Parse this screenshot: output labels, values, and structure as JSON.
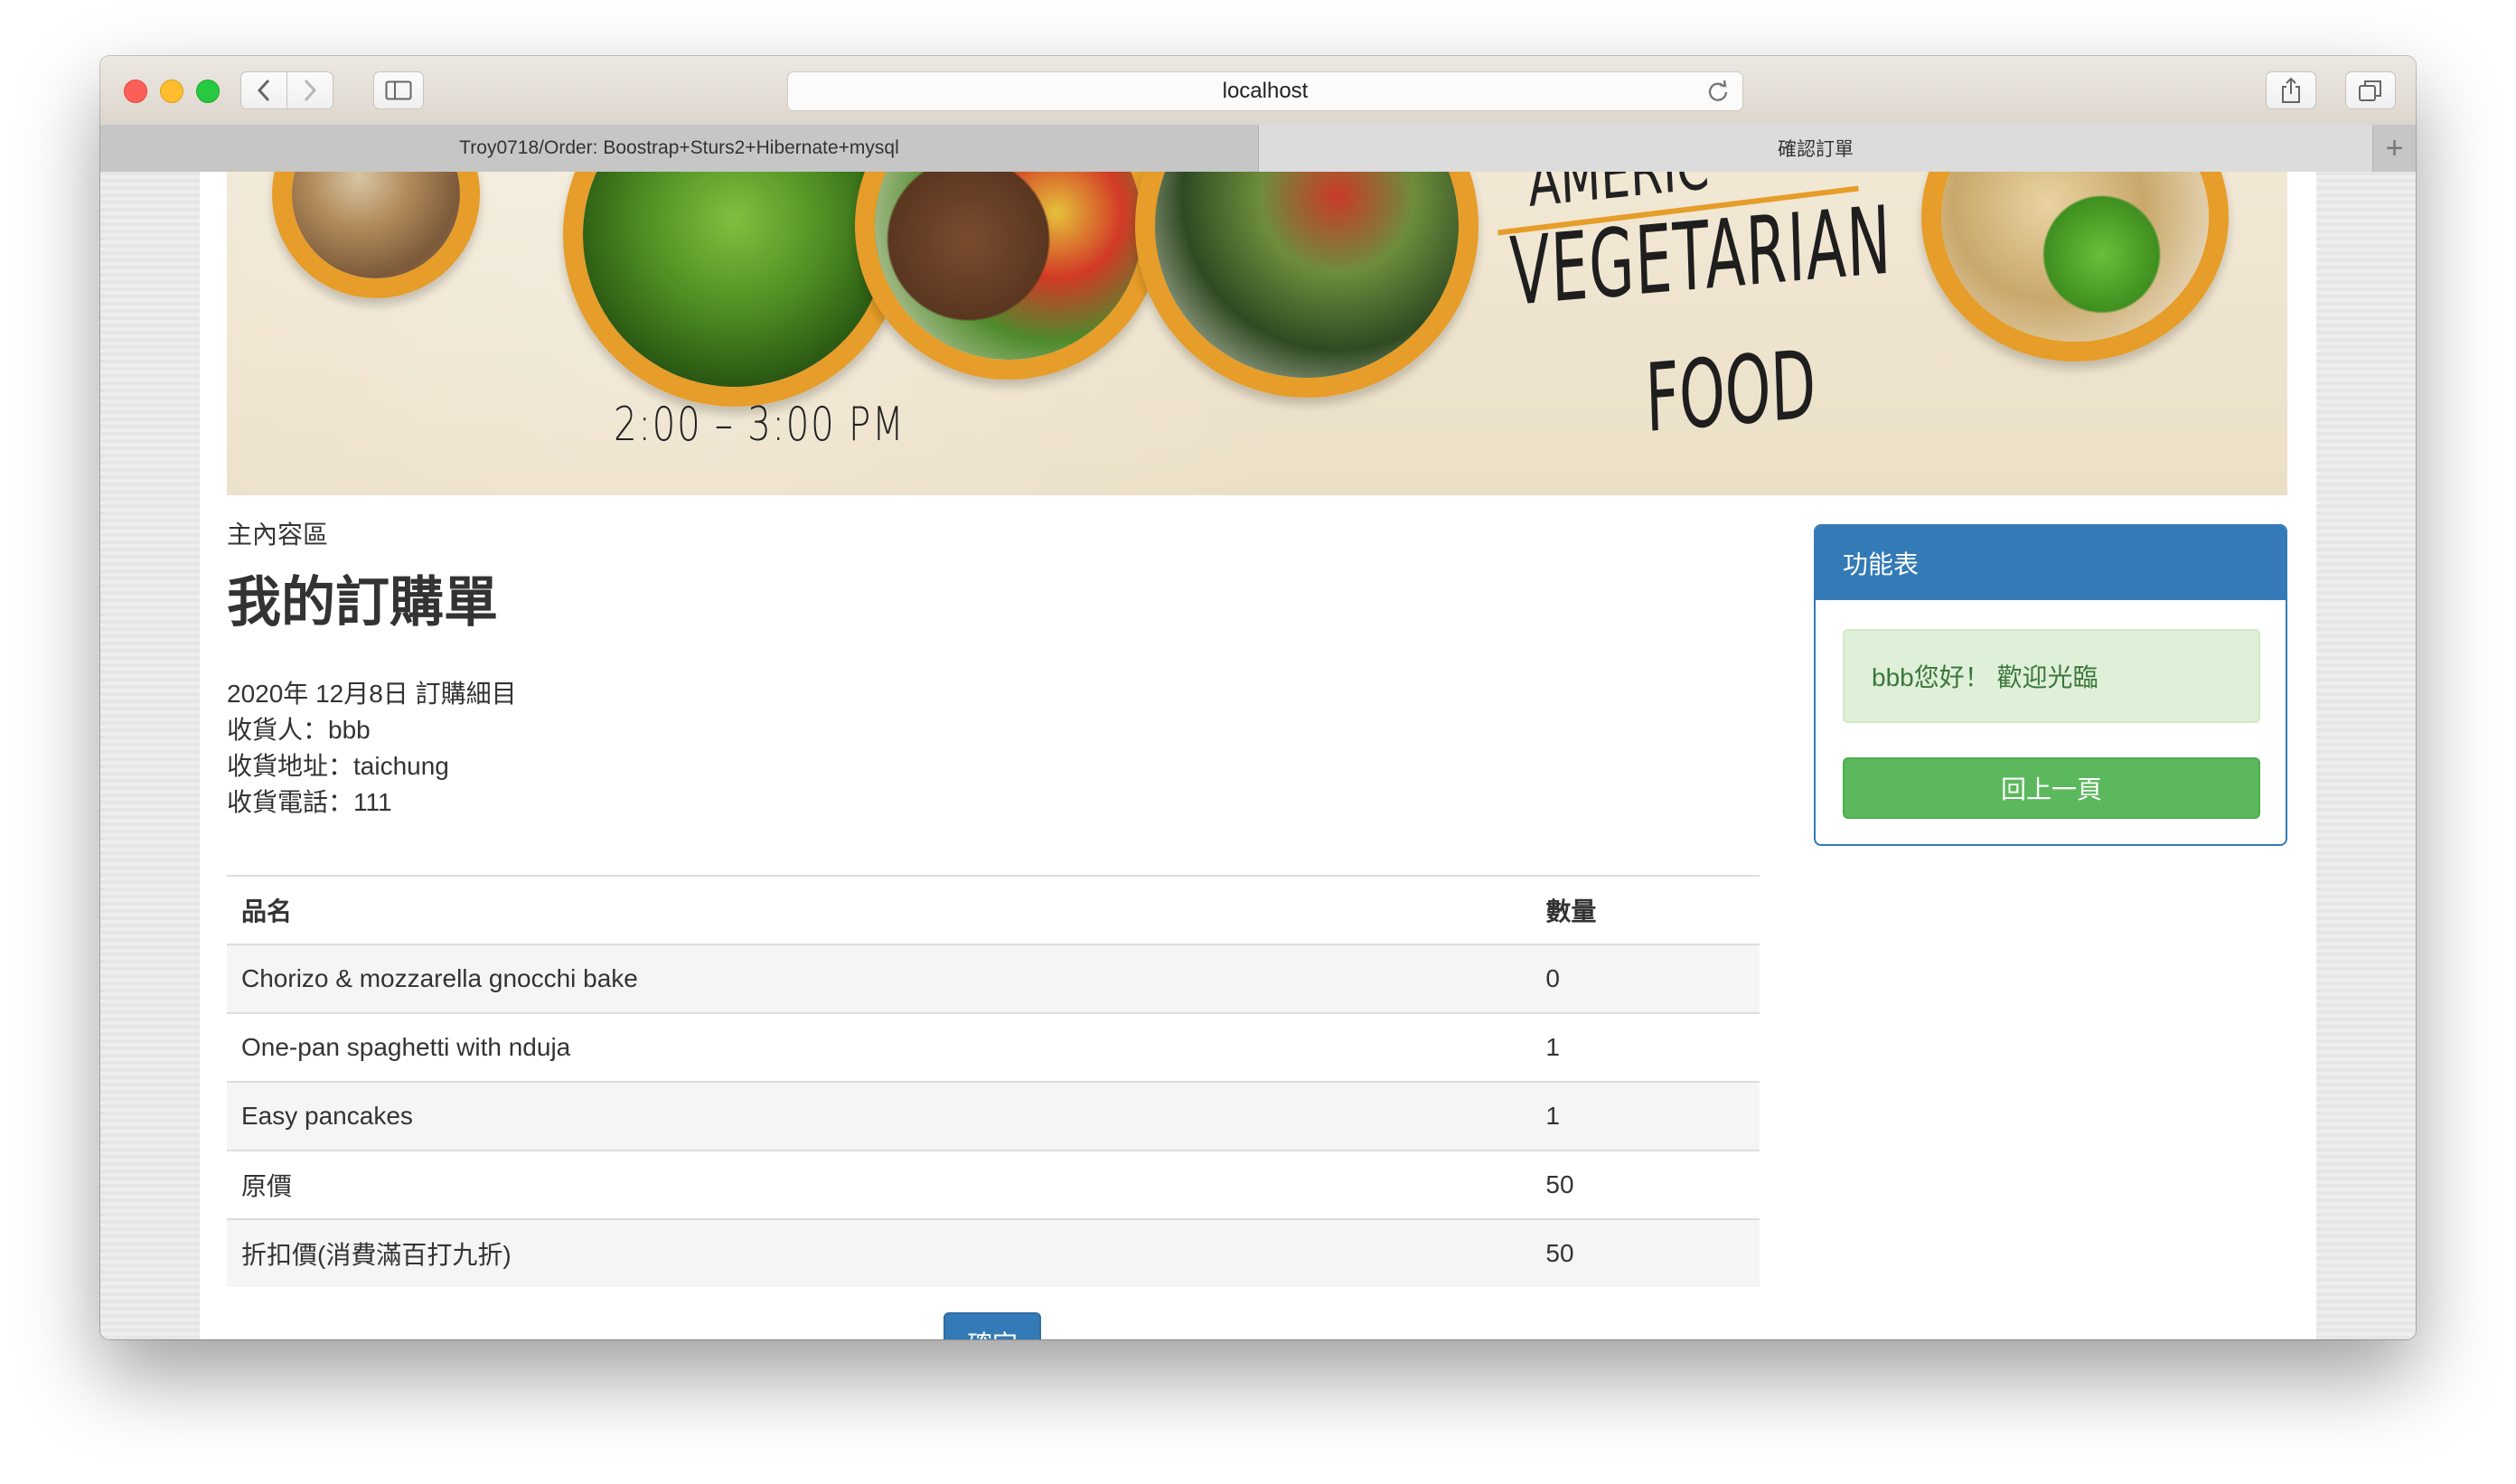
{
  "browser": {
    "url": "localhost",
    "tabs": [
      {
        "label": "Troy0718/Order: Boostrap+Sturs2+Hibernate+mysql"
      },
      {
        "label": "確認訂單"
      }
    ],
    "icons": {
      "back": "chevron-left-icon",
      "forward": "chevron-right-icon",
      "sidebar": "sidebar-icon",
      "reload": "reload-icon",
      "share": "share-icon",
      "tabs": "tabs-icon",
      "new_tab": "plus-icon"
    }
  },
  "banner": {
    "time": "2:00 – 3:00 PM",
    "top_text": "AMERIC",
    "title": "VEGETARIAN",
    "subtitle": "FOOD"
  },
  "main": {
    "section_label": "主內容區",
    "heading": "我的訂購單",
    "date_line": "2020年 12月8日 訂購細目",
    "recipient": "收貨人：bbb",
    "address": "收貨地址：taichung",
    "phone": "收貨電話：111",
    "table": {
      "headers": [
        "品名",
        "數量"
      ],
      "rows": [
        [
          "Chorizo & mozzarella gnocchi bake",
          "0"
        ],
        [
          "One-pan spaghetti with nduja",
          "1"
        ],
        [
          "Easy pancakes",
          "1"
        ],
        [
          "原價",
          "50"
        ],
        [
          "折扣價(消費滿百打九折)",
          "50"
        ]
      ]
    },
    "confirm_label": "確定"
  },
  "panel": {
    "title": "功能表",
    "greeting": "bbb您好！ 歡迎光臨",
    "back_label": "回上一頁"
  },
  "colors": {
    "primary": "#337ab7",
    "success": "#5cb85c",
    "alert_bg": "#dff0d8",
    "alert_text": "#3c763d",
    "banner_accent": "#e69d29"
  }
}
